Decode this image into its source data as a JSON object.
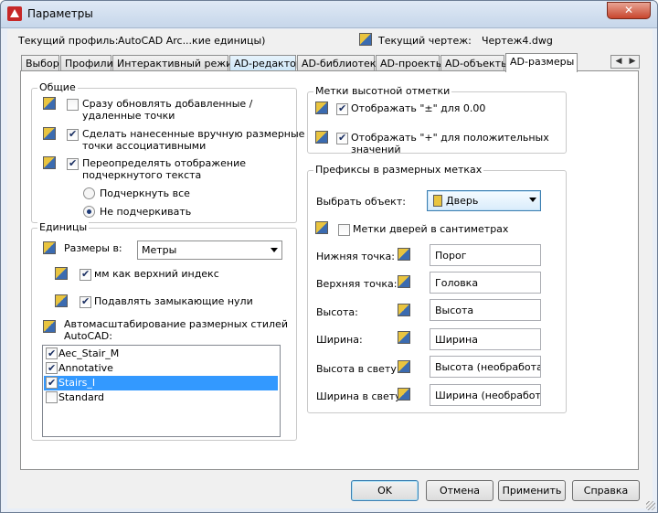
{
  "window": {
    "title": "Параметры",
    "close": "✕"
  },
  "header": {
    "profile_label": "Текущий профиль:",
    "profile_value": "AutoCAD Arc...кие единицы)",
    "drawing_label": "Текущий чертеж:",
    "drawing_value": "Чертеж4.dwg"
  },
  "tabs": [
    {
      "label": "Выбор"
    },
    {
      "label": "Профили"
    },
    {
      "label": "Интерактивный режим"
    },
    {
      "label": "AD-редактор"
    },
    {
      "label": "AD-библиотека"
    },
    {
      "label": "AD-проекты"
    },
    {
      "label": "AD-объекты"
    },
    {
      "label": "AD-размеры",
      "active": true
    }
  ],
  "general": {
    "title": "Общие",
    "auto_update": {
      "label": "Сразу обновлять добавленные /",
      "label2": "удаленные точки",
      "checked": false
    },
    "associative": {
      "label": "Сделать нанесенные вручную размерные",
      "label2": "точки ассоциативными",
      "checked": true
    },
    "override_underline": {
      "label": "Переопределять отображение",
      "label2": "подчеркнутого текста",
      "checked": true
    },
    "underline_all": {
      "label": "Подчеркнуть все",
      "selected": false
    },
    "no_underline": {
      "label": "Не подчеркивать",
      "selected": true
    }
  },
  "units": {
    "title": "Единицы",
    "dims_label": "Размеры в:",
    "dims_value": "Метры",
    "mm_super": {
      "label": "мм как верхний индекс",
      "checked": true
    },
    "suppress_zeros": {
      "label": "Подавлять замыкающие нули",
      "checked": true
    },
    "autoscale_label": "Автомасштабирование размерных стилей",
    "autoscale_label2": "AutoCAD:",
    "styles": [
      {
        "name": "Aec_Stair_M",
        "checked": true
      },
      {
        "name": "Annotative",
        "checked": true
      },
      {
        "name": "Stairs_I",
        "checked": true,
        "selected": true
      },
      {
        "name": "Standard",
        "checked": false
      }
    ]
  },
  "elevation": {
    "title": "Метки высотной отметки",
    "show_pm": {
      "label": "Отображать \"±\" для 0.00",
      "checked": true
    },
    "show_plus": {
      "label": "Отображать \"+\" для положительных",
      "label2": "значений",
      "checked": true
    }
  },
  "prefixes": {
    "title": "Префиксы в размерных метках",
    "object_label": "Выбрать объект:",
    "object_value": "Дверь",
    "door_cm": {
      "label": "Метки дверей в сантиметрах",
      "checked": false
    },
    "rows": [
      {
        "label": "Нижняя точка:",
        "value": "Порог"
      },
      {
        "label": "Верхняя точка:",
        "value": "Головка"
      },
      {
        "label": "Высота:",
        "value": "Высота"
      },
      {
        "label": "Ширина:",
        "value": "Ширина"
      },
      {
        "label": "Высота в свету:",
        "value": "Высота (необработанн"
      },
      {
        "label": "Ширина в свету:",
        "value": "Ширина (необработан"
      }
    ]
  },
  "buttons": {
    "ok": "OK",
    "cancel": "Отмена",
    "apply": "Применить",
    "help": "Справка"
  }
}
